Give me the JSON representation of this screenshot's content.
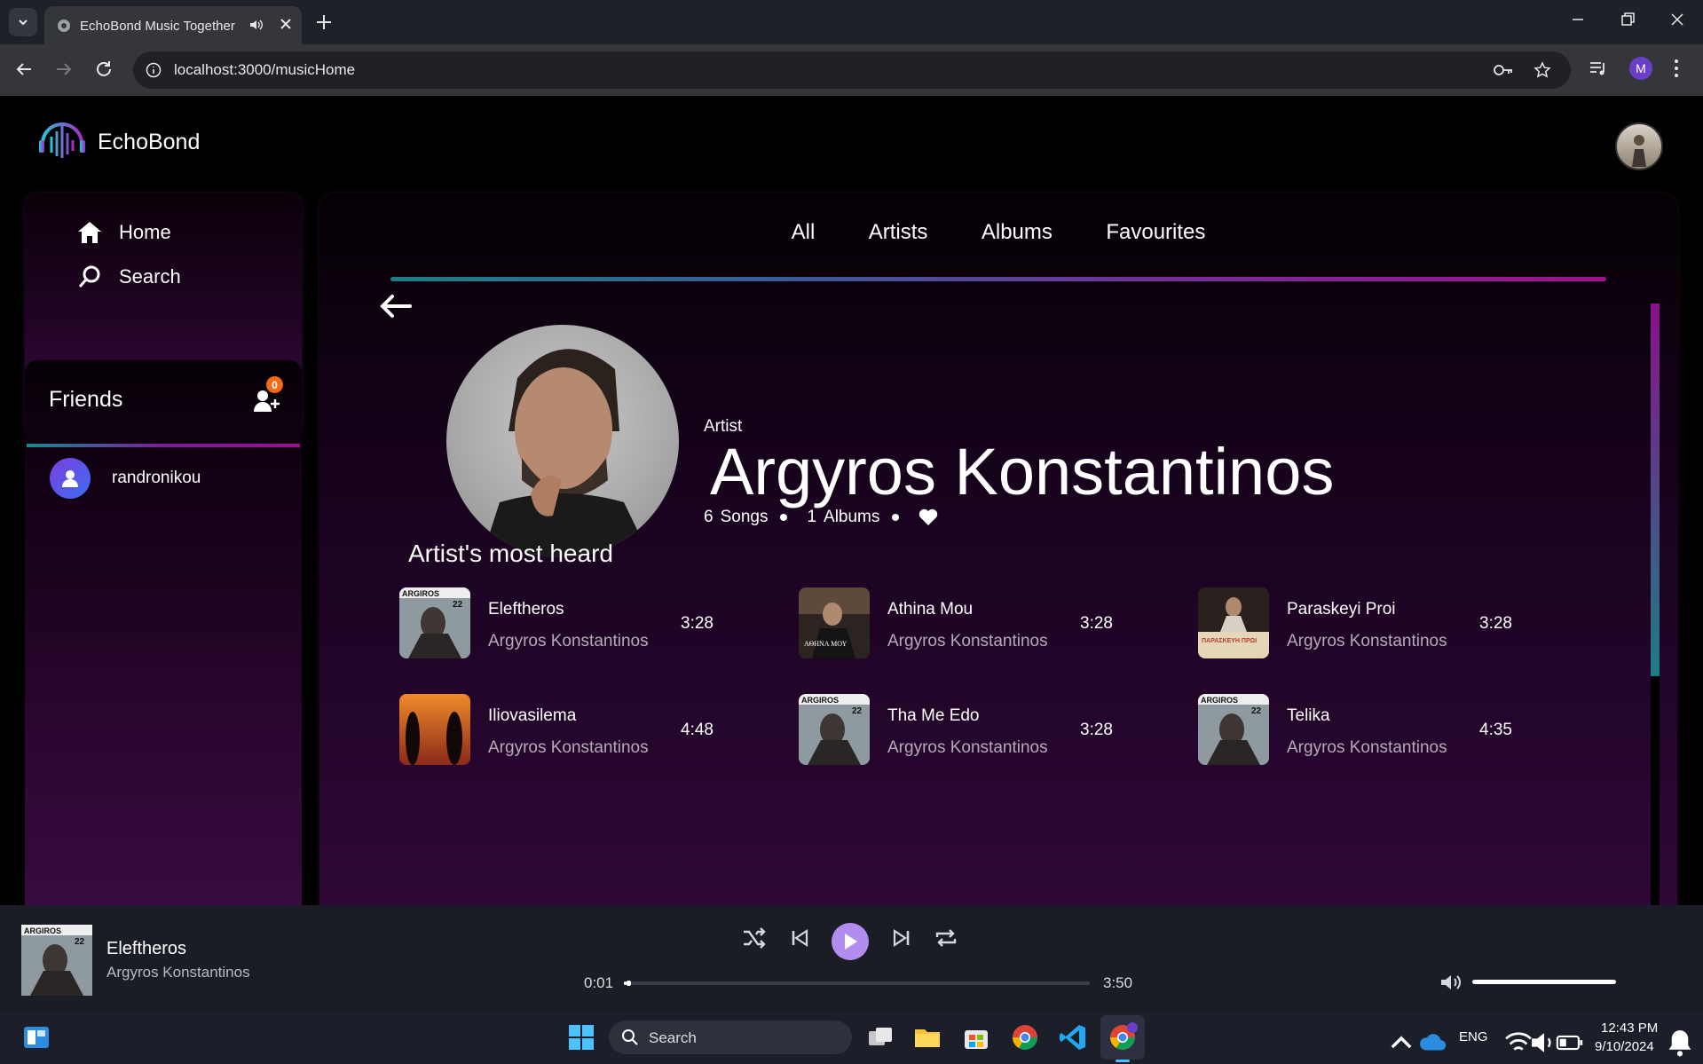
{
  "browser": {
    "tab_title": "EchoBond Music Together",
    "url": "localhost:3000/musicHome",
    "profile_initial": "M"
  },
  "app": {
    "brand": "EchoBond",
    "nav": {
      "home": "Home",
      "search": "Search"
    },
    "friends": {
      "title": "Friends",
      "badge_count": "0",
      "list": [
        {
          "name": "randronikou"
        }
      ]
    },
    "tabs": [
      "All",
      "Artists",
      "Albums",
      "Favourites"
    ],
    "artist": {
      "type": "Artist",
      "name": "Argyros Konstantinos",
      "songs_count": "6",
      "songs_label": "Songs",
      "albums_count": "1",
      "albums_label": "Albums"
    },
    "section_title": "Artist's most heard",
    "songs": [
      {
        "title": "Eleftheros",
        "artist": "Argyros Konstantinos",
        "duration": "3:28",
        "thumb": "album-22-cover"
      },
      {
        "title": "Athina Mou",
        "artist": "Argyros Konstantinos",
        "duration": "3:28",
        "thumb": "athina-mou-cover"
      },
      {
        "title": "Paraskeyi Proi",
        "artist": "Argyros Konstantinos",
        "duration": "3:28",
        "thumb": "paraskeyi-proi-cover"
      },
      {
        "title": "Iliovasilema",
        "artist": "Argyros Konstantinos",
        "duration": "4:48",
        "thumb": "sunset-cover"
      },
      {
        "title": "Tha Me Edo",
        "artist": "Argyros Konstantinos",
        "duration": "3:28",
        "thumb": "album-22-cover"
      },
      {
        "title": "Telika",
        "artist": "Argyros Konstantinos",
        "duration": "4:35",
        "thumb": "album-22-cover"
      }
    ],
    "cover_text": {
      "band": "ARGIROS",
      "number": "22",
      "athina": "ΑΘΗΝΑ ΜΟΥ",
      "paraskeyi": "ΠΑΡΑΣΚΕΥΗ ΠΡΩΙ"
    }
  },
  "player": {
    "title": "Eleftheros",
    "artist": "Argyros Konstantinos",
    "current_time": "0:01",
    "total_time": "3:50",
    "progress_fraction": 0.005,
    "volume_fraction": 1.0
  },
  "taskbar": {
    "search_label": "Search",
    "language": "ENG",
    "time": "12:43 PM",
    "date": "9/10/2024"
  },
  "colors": {
    "accent_purple": "#b38cf0",
    "badge_orange": "#f36a16",
    "gradient_teal": "#1a7f86",
    "gradient_magenta": "#a01090"
  }
}
